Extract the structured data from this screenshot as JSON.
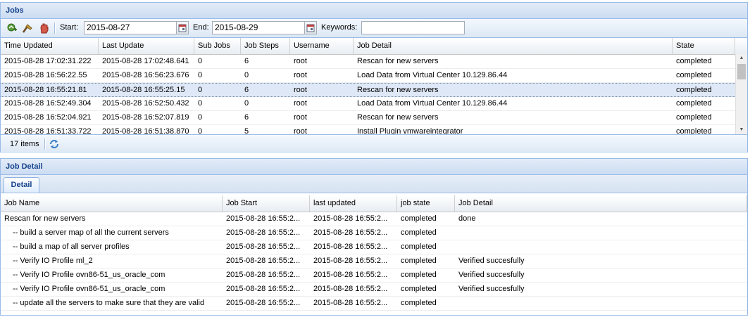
{
  "jobs_panel": {
    "title": "Jobs",
    "toolbar": {
      "start_label": "Start:",
      "start_value": "2015-08-27",
      "end_label": "End:",
      "end_value": "2015-08-29",
      "keywords_label": "Keywords:",
      "keywords_value": ""
    },
    "columns": [
      "Time Updated",
      "Last Update",
      "Sub Jobs",
      "Job Steps",
      "Username",
      "Job Detail",
      "State"
    ],
    "rows": [
      [
        "2015-08-28 17:02:31.222",
        "2015-08-28 17:02:48.641",
        "0",
        "6",
        "root",
        "Rescan for new servers",
        "completed"
      ],
      [
        "2015-08-28 16:56:22.55",
        "2015-08-28 16:56:23.676",
        "0",
        "0",
        "root",
        "Load Data from Virtual Center 10.129.86.44",
        "completed"
      ],
      [
        "2015-08-28 16:55:21.81",
        "2015-08-28 16:55:25.15",
        "0",
        "6",
        "root",
        "Rescan for new servers",
        "completed"
      ],
      [
        "2015-08-28 16:52:49.304",
        "2015-08-28 16:52:50.432",
        "0",
        "0",
        "root",
        "Load Data from Virtual Center 10.129.86.44",
        "completed"
      ],
      [
        "2015-08-28 16:52:04.921",
        "2015-08-28 16:52:07.819",
        "0",
        "6",
        "root",
        "Rescan for new servers",
        "completed"
      ],
      [
        "2015-08-28 16:51:33.722",
        "2015-08-28 16:51:38.870",
        "0",
        "5",
        "root",
        "Install Plugin vmwareintegrator",
        "completed"
      ]
    ],
    "selected_row": 2,
    "pager": {
      "items_text": "17 items"
    }
  },
  "detail_panel": {
    "title": "Job Detail",
    "tab_label": "Detail",
    "columns": [
      "Job Name",
      "Job Start",
      "last updated",
      "job state",
      "Job Detail"
    ],
    "rows": [
      [
        "Rescan for new servers",
        "2015-08-28 16:55:2...",
        "2015-08-28 16:55:2...",
        "completed",
        "done"
      ],
      [
        "-- build a server map of all the current servers",
        "2015-08-28 16:55:2...",
        "2015-08-28 16:55:2...",
        "completed",
        ""
      ],
      [
        "-- build a map of all server profiles",
        "2015-08-28 16:55:2...",
        "2015-08-28 16:55:2...",
        "completed",
        ""
      ],
      [
        "-- Verify IO Profile ml_2",
        "2015-08-28 16:55:2...",
        "2015-08-28 16:55:2...",
        "completed",
        "Verified succesfully"
      ],
      [
        "-- Verify IO Profile ovn86-51_us_oracle_com",
        "2015-08-28 16:55:2...",
        "2015-08-28 16:55:2...",
        "completed",
        "Verified succesfully"
      ],
      [
        "-- Verify IO Profile ovn86-51_us_oracle_com",
        "2015-08-28 16:55:2...",
        "2015-08-28 16:55:2...",
        "completed",
        "Verified succesfully"
      ],
      [
        "-- update all the servers to make sure that they are valid",
        "2015-08-28 16:55:2...",
        "2015-08-28 16:55:2...",
        "completed",
        ""
      ]
    ]
  },
  "icons": {
    "add": "add-job-icon",
    "edit": "edit-broom-icon",
    "stop": "stop-hand-icon",
    "calendar": "calendar-icon",
    "refresh": "refresh-icon"
  },
  "colors": {
    "header_text": "#15428b",
    "border": "#99bbe8",
    "selected_row": "#dfe8f6"
  }
}
